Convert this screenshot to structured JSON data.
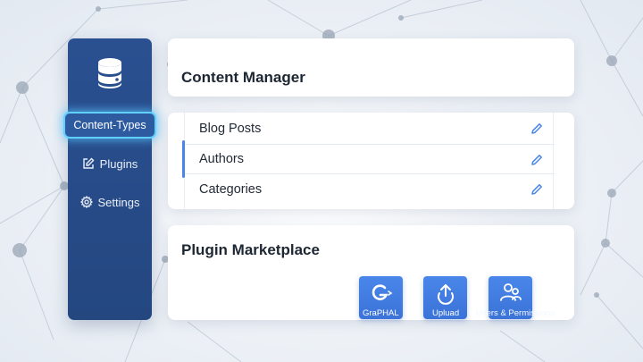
{
  "sidebar": {
    "logo_icon": "database-icon",
    "items": [
      {
        "label": "Content-Types",
        "icon": "none",
        "active": true
      },
      {
        "label": "Plugins",
        "icon": "edit-square-icon",
        "active": false
      },
      {
        "label": "Settings",
        "icon": "gear-icon",
        "active": false
      }
    ]
  },
  "content_manager": {
    "title": "Content Manager",
    "items": [
      {
        "label": "Blog Posts",
        "icon": "pencil-icon"
      },
      {
        "label": "Authors",
        "icon": "pencil-icon",
        "selected": true
      },
      {
        "label": "Categories",
        "icon": "pencil-icon"
      }
    ]
  },
  "marketplace": {
    "title": "Plugin Marketplace",
    "plugins": [
      {
        "label": "GraPHAL",
        "icon": "graphql-g-icon"
      },
      {
        "label": "Upluad",
        "icon": "upload-icon"
      },
      {
        "label": "Users & Permissions",
        "icon": "users-icon"
      }
    ]
  },
  "colors": {
    "sidebar": "#2a5091",
    "accent": "#4a86e8",
    "active_glow": "#5fd0ff",
    "background": "#e8edf3"
  }
}
